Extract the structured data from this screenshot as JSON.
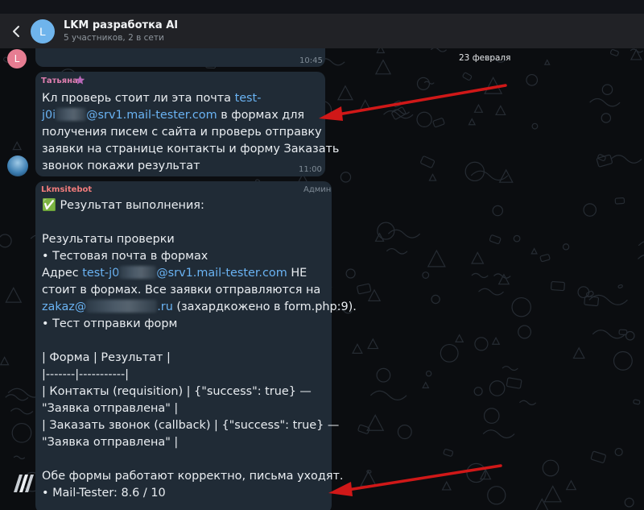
{
  "header": {
    "title": "LKM разработка AI",
    "subtitle": "5 участников, 2 в сети",
    "avatar_letter": "L"
  },
  "date_label": "23 февраля",
  "messages": [
    {
      "sender_avatar_letter": "L",
      "time": "10:45"
    },
    {
      "sender": "Татьяна",
      "text": {
        "l1_a": "Кл проверь стоит ли эта почта ",
        "l1_link": "test-",
        "l2_link_a": "j0i",
        "l2_link_b": "@srv1.mail-tester.com",
        "l2_b": " в формах для",
        "l3": "получения писем с сайта и проверь отправку",
        "l4": "заявки на странице контакты и форму Заказать",
        "l5": "звонок покажи результат"
      },
      "time": "11:00"
    },
    {
      "sender": "Lkmsitebot",
      "role": "Админ",
      "text": {
        "l1": "✅ Результат выполнения:",
        "l3": "Результаты проверки",
        "l4": "• Тестовая почта в формах",
        "l5_a": "Адрес ",
        "l5_link_a": "test-j0",
        "l5_link_b": "@srv1.mail-tester.com",
        "l5_b": " НЕ",
        "l6": "стоит в формах. Все заявки отправляются на",
        "l7_link_a": "zakaz@",
        "l7_link_b": ".ru",
        "l7_b": " (захардкожено в form.php:9).",
        "l8": "• Тест отправки форм",
        "l10": "| Форма | Результат |",
        "l11": "|-------|-----------|",
        "l12": "| Контакты (requisition) | {\"success\": true} —",
        "l13": "\"Заявка отправлена\" |",
        "l14": "| Заказать звонок (callback) | {\"success\": true} —",
        "l15": "\"Заявка отправлена\" |",
        "l17": "Обе формы работают корректно, письма уходят.",
        "l18": "• Mail-Tester: 8.6 / 10"
      }
    }
  ],
  "colors": {
    "tatyana_name": "#e07fb0",
    "bot_name": "#ef7b7b",
    "link": "#6ab3f3",
    "arrow": "#d01818",
    "bubble": "#202b36"
  }
}
